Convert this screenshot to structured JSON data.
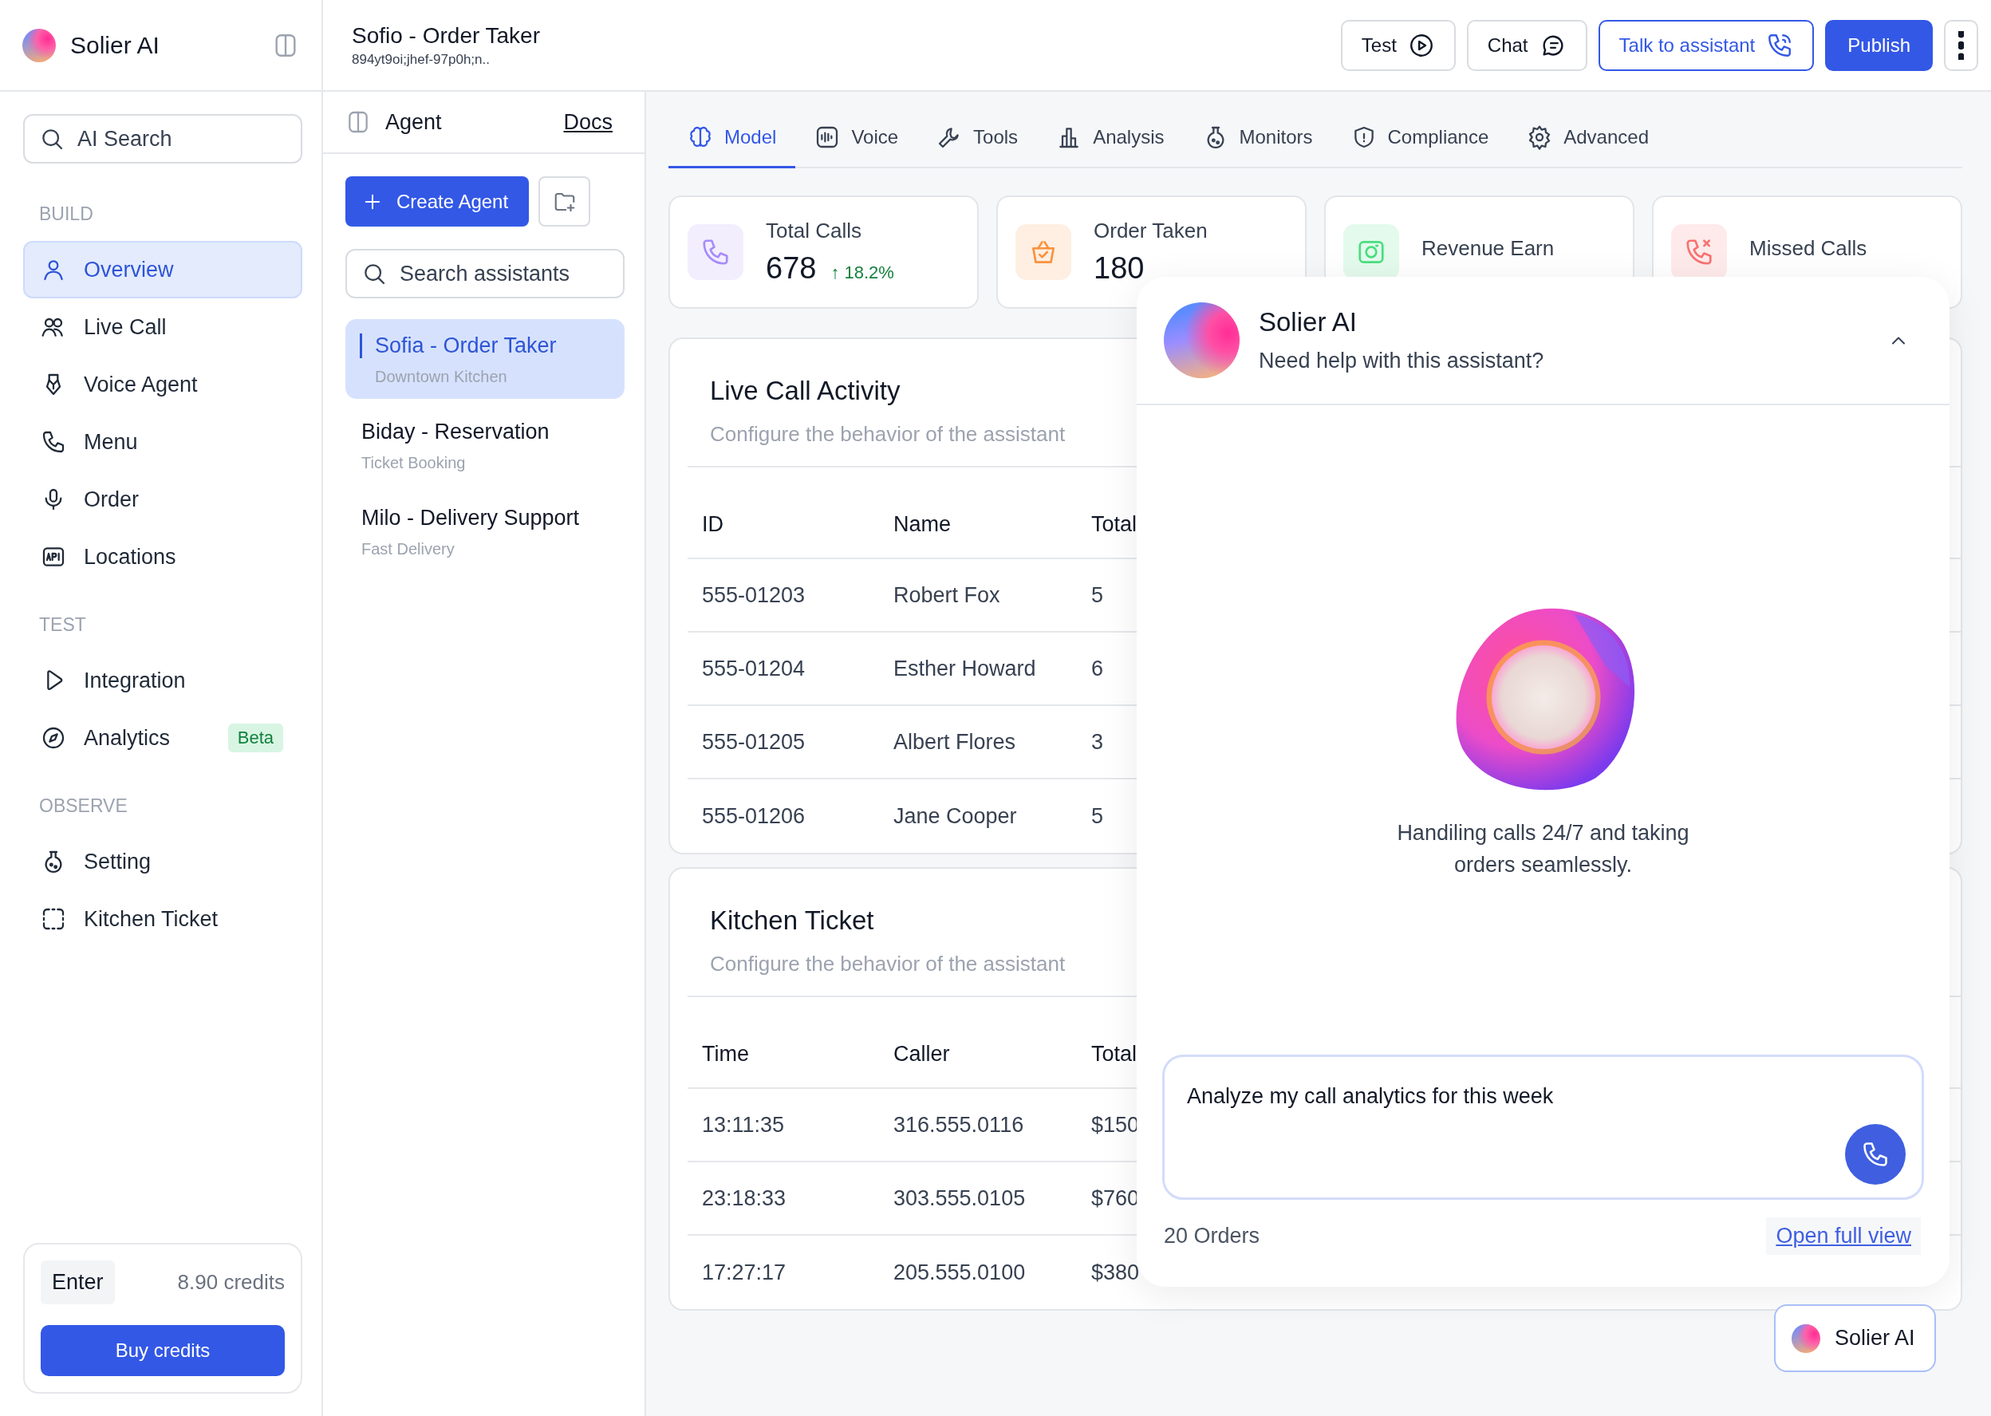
{
  "brand": {
    "name": "Solier AI"
  },
  "sidebar": {
    "search": {
      "placeholder": "AI Search"
    },
    "sections": [
      {
        "title": "BUILD",
        "items": [
          {
            "label": "Overview",
            "selected": true
          },
          {
            "label": "Live Call",
            "selected": false
          },
          {
            "label": "Voice Agent",
            "selected": false
          },
          {
            "label": "Menu",
            "selected": false
          },
          {
            "label": "Order",
            "selected": false
          },
          {
            "label": "Locations",
            "selected": false
          }
        ]
      },
      {
        "title": "TEST",
        "items": [
          {
            "label": "Integration",
            "selected": false
          },
          {
            "label": "Analytics",
            "selected": false,
            "badge": "Beta"
          }
        ]
      },
      {
        "title": "OBSERVE",
        "items": [
          {
            "label": "Setting",
            "selected": false
          },
          {
            "label": "Kitchen Ticket",
            "selected": false
          }
        ]
      }
    ],
    "credits": {
      "key": "Enter",
      "amount": "8.90 credits",
      "button": "Buy credits"
    }
  },
  "header": {
    "title": "Sofio - Order Taker",
    "subtitle": "894yt9oi;jhef-97p0h;n..",
    "buttons": [
      {
        "label": "Test",
        "kind": "outline"
      },
      {
        "label": "Chat",
        "kind": "outline"
      },
      {
        "label": "Talk to assistant",
        "kind": "accent"
      },
      {
        "label": "Publish",
        "kind": "primary"
      }
    ]
  },
  "agents": {
    "title": "Agent",
    "docs": "Docs",
    "create": "Create Agent",
    "search": {
      "placeholder": "Search assistants"
    },
    "items": [
      {
        "name": "Sofia - Order Taker",
        "detail": "Downtown Kitchen",
        "selected": true
      },
      {
        "name": "Biday - Reservation",
        "detail": "Ticket Booking",
        "selected": false
      },
      {
        "name": "Milo - Delivery Support",
        "detail": "Fast Delivery",
        "selected": false
      }
    ]
  },
  "tabs": [
    {
      "label": "Model",
      "selected": true
    },
    {
      "label": "Voice",
      "selected": false
    },
    {
      "label": "Tools",
      "selected": false
    },
    {
      "label": "Analysis",
      "selected": false
    },
    {
      "label": "Monitors",
      "selected": false
    },
    {
      "label": "Compliance",
      "selected": false
    },
    {
      "label": "Advanced",
      "selected": false
    }
  ],
  "stats": [
    {
      "label": "Total Calls",
      "value": "678",
      "change": "↑ 18.2%",
      "rising": true,
      "color": "#a78bfa"
    },
    {
      "label": "Order Taken",
      "value": "180",
      "color": "#fb923c"
    },
    {
      "label": "Revenue Earn",
      "color": "#4ade80"
    },
    {
      "label": "Missed Calls",
      "color": "#f87171"
    }
  ],
  "tables": [
    {
      "title": "Live Call Activity",
      "subtitle": "Configure the behavior of the assistant",
      "columns": [
        "ID",
        "Name",
        "Total"
      ],
      "rows": [
        [
          "555-01203",
          "Robert Fox",
          "5"
        ],
        [
          "555-01204",
          "Esther Howard",
          "6"
        ],
        [
          "555-01205",
          "Albert Flores",
          "3"
        ],
        [
          "555-01206",
          "Jane Cooper",
          "5"
        ]
      ]
    },
    {
      "title": "Kitchen Ticket",
      "subtitle": "Configure the behavior of the assistant",
      "columns": [
        "Time",
        "Caller",
        "Total"
      ],
      "rows": [
        [
          "13:11:35",
          "316.555.0116",
          "$150"
        ],
        [
          "23:18:33",
          "303.555.0105",
          "$760"
        ],
        [
          "17:27:17",
          "205.555.0100",
          "$380"
        ]
      ]
    }
  ],
  "assistant": {
    "title": "Solier AI",
    "subtitle": "Need help with this assistant?",
    "message": "Handiling calls 24/7 and taking orders seamlessly.",
    "input": "Analyze my call analytics for this week",
    "orders": "20 Orders",
    "link": "Open full view"
  },
  "launcher": {
    "label": "Solier AI"
  }
}
